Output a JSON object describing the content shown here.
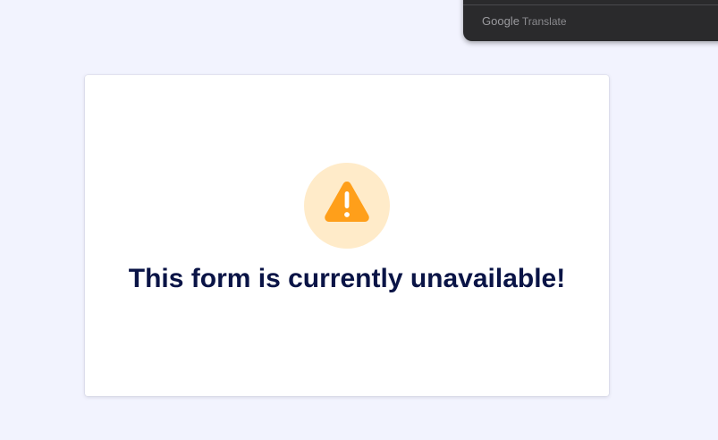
{
  "translate_popup": {
    "brand_google": "Google",
    "brand_product": "Translate"
  },
  "form_card": {
    "icon": "warning-triangle-icon",
    "message": "This form is currently unavailable!",
    "colors": {
      "icon": "#ff9f1a",
      "icon_background": "#ffebc9",
      "message": "#0a1446"
    }
  }
}
